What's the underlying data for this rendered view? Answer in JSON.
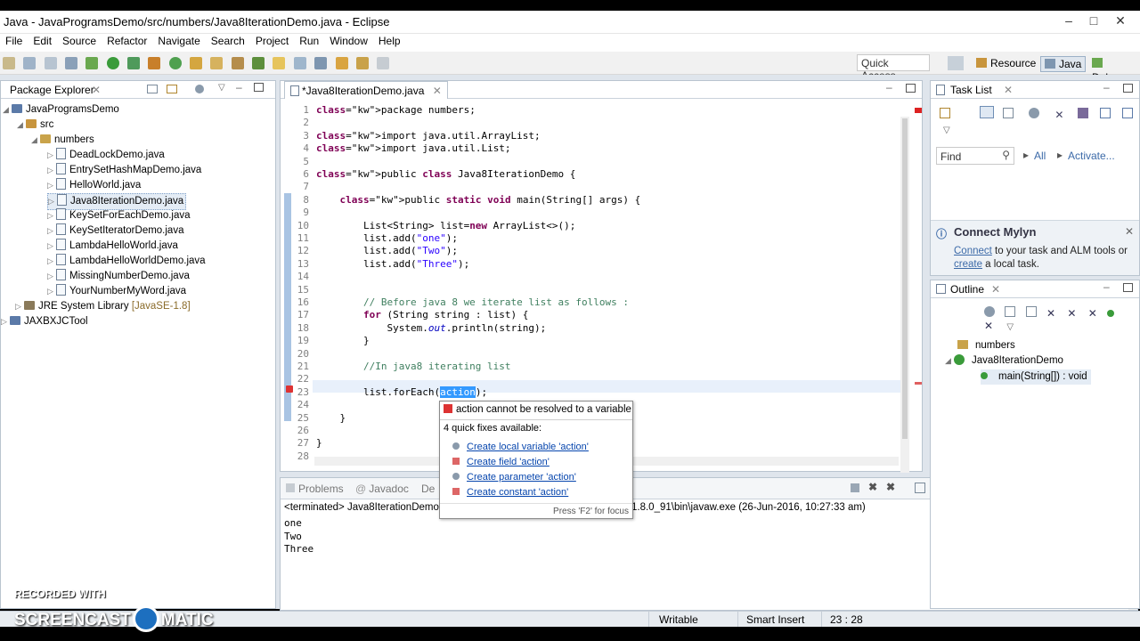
{
  "window": {
    "title": "Java - JavaProgramsDemo/src/numbers/Java8IterationDemo.java - Eclipse"
  },
  "menu": [
    "File",
    "Edit",
    "Source",
    "Refactor",
    "Navigate",
    "Search",
    "Project",
    "Run",
    "Window",
    "Help"
  ],
  "toolbar": {
    "quick_access": "Quick Access",
    "perspectives": [
      "Resource",
      "Java",
      "Debug"
    ]
  },
  "package_explorer": {
    "title": "Package Explorer",
    "project": "JavaProgramsDemo",
    "src": "src",
    "package": "numbers",
    "files": [
      "DeadLockDemo.java",
      "EntrySetHashMapDemo.java",
      "HelloWorld.java",
      "Java8IterationDemo.java",
      "KeySetForEachDemo.java",
      "KeySetIteratorDemo.java",
      "LambdaHelloWorld.java",
      "LambdaHelloWorldDemo.java",
      "MissingNumberDemo.java",
      "YourNumberMyWord.java"
    ],
    "jre": "JRE System Library",
    "jre_version": "[JavaSE-1.8]",
    "other_project": "JAXBXJCTool"
  },
  "editor": {
    "tab": "*Java8IterationDemo.java",
    "lines": [
      {
        "n": "1",
        "t": "package numbers;"
      },
      {
        "n": "2",
        "t": ""
      },
      {
        "n": "3",
        "t": "import java.util.ArrayList;"
      },
      {
        "n": "4",
        "t": "import java.util.List;"
      },
      {
        "n": "5",
        "t": ""
      },
      {
        "n": "6",
        "t": "public class Java8IterationDemo {"
      },
      {
        "n": "7",
        "t": ""
      },
      {
        "n": "8",
        "t": "    public static void main(String[] args) {"
      },
      {
        "n": "9",
        "t": ""
      },
      {
        "n": "10",
        "t": "        List<String> list=new ArrayList<>();"
      },
      {
        "n": "11",
        "t": "        list.add(\"one\");"
      },
      {
        "n": "12",
        "t": "        list.add(\"Two\");"
      },
      {
        "n": "13",
        "t": "        list.add(\"Three\");"
      },
      {
        "n": "14",
        "t": ""
      },
      {
        "n": "15",
        "t": ""
      },
      {
        "n": "16",
        "t": "        // Before java 8 we iterate list as follows :"
      },
      {
        "n": "17",
        "t": "        for (String string : list) {"
      },
      {
        "n": "18",
        "t": "            System.out.println(string);"
      },
      {
        "n": "19",
        "t": "        }"
      },
      {
        "n": "20",
        "t": ""
      },
      {
        "n": "21",
        "t": "        //In java8 iterating list"
      },
      {
        "n": "22",
        "t": ""
      },
      {
        "n": "23",
        "t": "        list.forEach(action);"
      },
      {
        "n": "24",
        "t": ""
      },
      {
        "n": "25",
        "t": "    }"
      },
      {
        "n": "26",
        "t": ""
      },
      {
        "n": "27",
        "t": "}"
      },
      {
        "n": "28",
        "t": ""
      }
    ]
  },
  "quickfix": {
    "error": "action cannot be resolved to a variable",
    "count": "4 quick fixes available:",
    "fixes": [
      "Create local variable 'action'",
      "Create field 'action'",
      "Create parameter 'action'",
      "Create constant 'action'"
    ],
    "hint": "Press 'F2' for focus"
  },
  "console": {
    "tabs": [
      "Problems",
      "Javadoc",
      "De"
    ],
    "header_left": "<terminated> Java8IterationDemo",
    "header_right": "1.8.0_91\\bin\\javaw.exe (26-Jun-2016, 10:27:33 am)",
    "output": [
      "one",
      "Two",
      "Three"
    ]
  },
  "task_list": {
    "title": "Task List",
    "find": "Find",
    "all": "All",
    "activate": "Activate..."
  },
  "mylyn": {
    "title": "Connect Mylyn",
    "connect": "Connect",
    "text1": " to your task and ALM tools or",
    "create": "create",
    "text2": " a local task."
  },
  "outline": {
    "title": "Outline",
    "package": "numbers",
    "class": "Java8IterationDemo",
    "method": "main(String[]) : void"
  },
  "status": {
    "writable": "Writable",
    "insert": "Smart Insert",
    "position": "23 : 28"
  },
  "watermark": {
    "line1": "RECORDED WITH",
    "line2": "SCREENCAST",
    "line3": "MATIC"
  }
}
